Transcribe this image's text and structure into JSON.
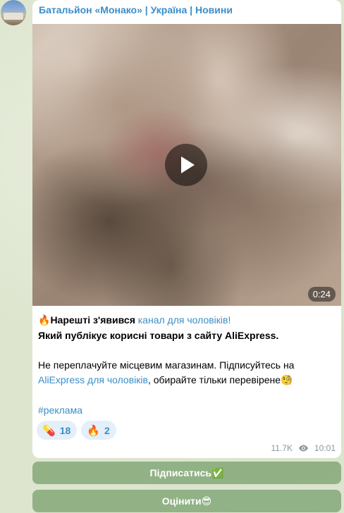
{
  "channel": {
    "name": "Батальйон «Монако» | Україна | Новини"
  },
  "video": {
    "duration": "0:24"
  },
  "message": {
    "line1_emoji": "🔥",
    "line1_bold": "Нарешті з'явився",
    "line1_link": "канал для чоловіків!",
    "line2_bold": "Який публікує корисні товари з сайту AliExpress.",
    "line3_text": "Не переплачуйте місцевим магазинам. Підписуйтесь на",
    "line4_link": "AliExpress для чоловіків",
    "line4_text": ", обирайте тільки перевірене",
    "line4_emoji": "🧐",
    "hashtag": "#реклама"
  },
  "reactions": [
    {
      "emoji": "💊",
      "count": "18"
    },
    {
      "emoji": "🔥",
      "count": "2"
    }
  ],
  "meta": {
    "views": "11.7K",
    "time": "10:01"
  },
  "buttons": {
    "subscribe_label": "Підписатись✅",
    "rate_label": "Оцінити😎"
  }
}
